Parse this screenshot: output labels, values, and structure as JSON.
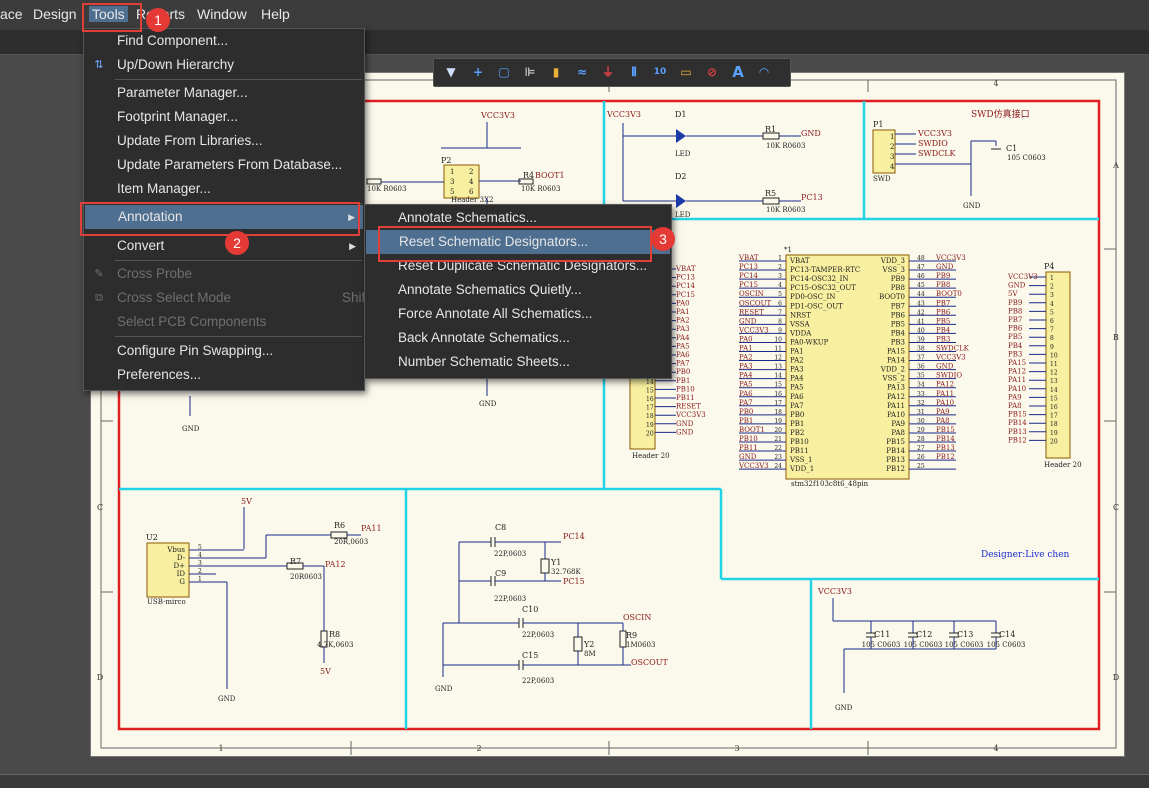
{
  "menubar": {
    "items": [
      {
        "label": "ace"
      },
      {
        "label": "Design"
      },
      {
        "label": "Tools"
      },
      {
        "label": "Reports"
      },
      {
        "label": "Window"
      },
      {
        "label": "Help"
      }
    ]
  },
  "toolbar": {
    "icons": [
      "filter-icon",
      "crosshair-icon",
      "select-rect-icon",
      "align-icon",
      "component-icon",
      "wire-icon",
      "ground-icon",
      "bus-icon",
      "net-label-icon",
      "port-icon",
      "no-erc-icon",
      "text-icon",
      "arc-icon"
    ]
  },
  "tools_menu": {
    "items": [
      {
        "label": "Find Component...",
        "enabled": true
      },
      {
        "label": "Up/Down Hierarchy",
        "enabled": true,
        "icon": "hierarchy-icon"
      },
      {
        "label": "Parameter Manager...",
        "enabled": true
      },
      {
        "label": "Footprint Manager...",
        "enabled": true
      },
      {
        "label": "Update From Libraries...",
        "enabled": true
      },
      {
        "label": "Update Parameters From Database...",
        "enabled": true
      },
      {
        "label": "Item Manager...",
        "enabled": true
      },
      {
        "label": "Annotation",
        "enabled": true,
        "submenu": true
      },
      {
        "label": "Convert",
        "enabled": true,
        "submenu": true
      },
      {
        "label": "Cross Probe",
        "enabled": false,
        "icon": "cross-probe-icon"
      },
      {
        "label": "Cross Select Mode",
        "enabled": false,
        "shortcut": "Shift+Ctrl+X",
        "icon": "cross-select-icon"
      },
      {
        "label": "Select PCB Components",
        "enabled": false
      },
      {
        "label": "Configure Pin Swapping...",
        "enabled": true
      },
      {
        "label": "Preferences...",
        "enabled": true
      }
    ]
  },
  "annotation_submenu": {
    "items": [
      {
        "label": "Annotate Schematics..."
      },
      {
        "label": "Reset Schematic Designators..."
      },
      {
        "label": "Reset Duplicate Schematic Designators..."
      },
      {
        "label": "Annotate Schematics Quietly..."
      },
      {
        "label": "Force Annotate All Schematics..."
      },
      {
        "label": "Back Annotate Schematics..."
      },
      {
        "label": "Number Schematic Sheets..."
      }
    ]
  },
  "badges": [
    "1",
    "2",
    "3"
  ],
  "sheet": {
    "col_labels": [
      "1",
      "2",
      "3",
      "4"
    ],
    "row_labels": [
      "A",
      "B",
      "C",
      "D"
    ],
    "designer": "Designer:Live chen",
    "swd_title": "SWD仿真接口",
    "labels": {
      "vcc_top": "VCC3V3",
      "p2": "P2",
      "header2x3": "Header 3X2",
      "r4": "R4",
      "boot1": "BOOT1",
      "r4v": "10K R0603",
      "r3v": "10K R0603",
      "d1": "D1",
      "d2": "D2",
      "led": "LED",
      "r1": "R1",
      "r1v": "10K R0603",
      "r5": "R5",
      "r5v": "10K R0603",
      "gnd": "GND",
      "pc13": "PC13",
      "p1": "P1",
      "swd": "SWD",
      "swdio": "SWDIO",
      "swdclk": "SWDCLK",
      "c1": "C1",
      "c1v": "105 C0603",
      "u1": "*1",
      "mcu": "stm32f103c8t6_48pin",
      "p4": "P4",
      "header20": "Header 20",
      "u2": "U2",
      "usb": "USB-mirco",
      "r6": "R6",
      "r6v": "20R,0603",
      "r7": "R7",
      "r7v": "20R0603",
      "r8": "R8",
      "r8v": "4.7K,0603",
      "pa11": "PA11",
      "pa12": "PA12",
      "v5": "5V",
      "c8": "C8",
      "c8v": "22P,0603",
      "c9": "C9",
      "c9v": "22P,0603",
      "y1": "Y1",
      "y1v": "32.768K",
      "pc14": "PC14",
      "pc15": "PC15",
      "c10": "C10",
      "c10v": "22P,0603",
      "c15": "C15",
      "c15v": "22P,0603",
      "y2": "Y2",
      "y2v": "8M",
      "r9": "R9",
      "r9v": "1M0603",
      "oscin": "OSCIN",
      "oscout": "OSCOUT",
      "c11": "C11",
      "c12": "C12",
      "c13": "C13",
      "c14": "C14",
      "capv": "105 C0603"
    },
    "mcu_left_pins": [
      "VBAT",
      "PC13-TAMPER-RTC",
      "PC14-OSC32_IN",
      "PC15-OSC32_OUT",
      "PD0-OSC_IN",
      "PD1-OSC_OUT",
      "NRST",
      "VSSA",
      "VDDA",
      "PA0-WKUP",
      "PA1",
      "PA2",
      "PA3",
      "PA4",
      "PA5",
      "PA6",
      "PA7",
      "PB0",
      "PB1",
      "PB2",
      "PB10",
      "PB11",
      "VSS_1",
      "VDD_1"
    ],
    "mcu_right_pins": [
      "VDD_3",
      "VSS_3",
      "PB9",
      "PB8",
      "BOOT0",
      "PB7",
      "PB6",
      "PB5",
      "PB4",
      "PB3",
      "PA15",
      "PA14",
      "VDD_2",
      "VSS_2",
      "PA13",
      "PA12",
      "PA11",
      "PA10",
      "PA9",
      "PA8",
      "PB15",
      "PB14",
      "PB13",
      "PB12"
    ],
    "mcu_left_nets": [
      "VBAT",
      "PC13",
      "PC14",
      "PC15",
      "OSCIN",
      "OSCOUT",
      "RESET",
      "GND",
      "VCC3V3",
      "PA0",
      "PA1",
      "PA2",
      "PA3",
      "PA4",
      "PA5",
      "PA6",
      "PA7",
      "PB0",
      "PB1",
      "BOOT1",
      "PB10",
      "PB11",
      "GND",
      "VCC3V3"
    ],
    "mcu_right_nets": [
      "VCC3V3",
      "GND",
      "PB9",
      "PB8",
      "BOOT0",
      "PB7",
      "PB6",
      "PB5",
      "PB4",
      "PB3",
      "SWDCLK",
      "VCC3V3",
      "GND",
      "SWDIO",
      "PA12",
      "PA11",
      "PA10",
      "PA9",
      "PA8",
      "PB15",
      "PB14",
      "PB13",
      "PB12"
    ],
    "p3_nets": [
      "VBAT",
      "PC13",
      "PC14",
      "PC15",
      "PA0",
      "PA1",
      "PA2",
      "PA3",
      "PA4",
      "PA5",
      "PA6",
      "PA7",
      "PB0",
      "PB1",
      "PB10",
      "PB11",
      "RESET",
      "VCC3V3",
      "GND",
      "GND"
    ],
    "p4_nets": [
      "VCC3V3",
      "GND",
      "5V",
      "PB9",
      "PB8",
      "PB7",
      "PB6",
      "PB5",
      "PB4",
      "PB3",
      "PA15",
      "PA12",
      "PA11",
      "PA10",
      "PA9",
      "PA8",
      "PB15",
      "PB14",
      "PB13",
      "PB12"
    ]
  }
}
